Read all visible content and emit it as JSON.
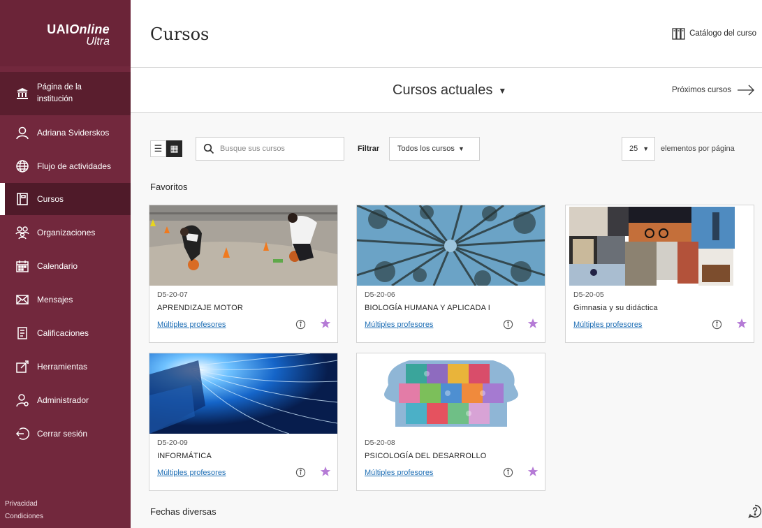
{
  "brand": {
    "line1_bold": "UAI",
    "line1_italic": "Online",
    "line2": "Ultra"
  },
  "sidebar": {
    "institution": {
      "line1": "Página de la",
      "line2": "institución"
    },
    "items": [
      {
        "label": "Adriana Sviderskos"
      },
      {
        "label": "Flujo de actividades"
      },
      {
        "label": "Cursos"
      },
      {
        "label": "Organizaciones"
      },
      {
        "label": "Calendario"
      },
      {
        "label": "Mensajes"
      },
      {
        "label": "Calificaciones"
      },
      {
        "label": "Herramientas"
      },
      {
        "label": "Administrador"
      },
      {
        "label": "Cerrar sesión"
      }
    ],
    "footer": {
      "privacy": "Privacidad",
      "terms": "Condiciones"
    }
  },
  "header": {
    "title": "Cursos",
    "catalog": "Catálogo del curso"
  },
  "subbar": {
    "current": "Cursos actuales",
    "upcoming": "Próximos cursos"
  },
  "toolbar": {
    "search_placeholder": "Busque sus cursos",
    "filter_label": "Filtrar",
    "filter_value": "Todos los cursos",
    "per_page_value": "25",
    "per_page_label": "elementos por página"
  },
  "sections": {
    "favorites": "Favoritos",
    "misc_dates": "Fechas diversas"
  },
  "courses": [
    {
      "code": "D5-20-07",
      "name": "APRENDIZAJE MOTOR",
      "instructors": "Múltiples profesores",
      "image": "motor-learning-photo"
    },
    {
      "code": "D5-20-06",
      "name": "BIOLOGÍA HUMANA Y APLICADA I",
      "instructors": "Múltiples profesores",
      "image": "forest-canopy-photo"
    },
    {
      "code": "D5-20-05",
      "name": "Gimnasia y su didáctica",
      "instructors": "Múltiples profesores",
      "image": "sports-collage-photo"
    },
    {
      "code": "D5-20-09",
      "name": "INFORMÁTICA",
      "instructors": "Múltiples profesores",
      "image": "laptop-light-photo"
    },
    {
      "code": "D5-20-08",
      "name": "PSICOLOGÍA DEL DESARROLLO",
      "instructors": "Múltiples profesores",
      "image": "puzzle-heads-illustration"
    }
  ],
  "colors": {
    "sidebar": "#72283d",
    "accent_star": "#b57bd6",
    "link": "#1f6fb5"
  }
}
